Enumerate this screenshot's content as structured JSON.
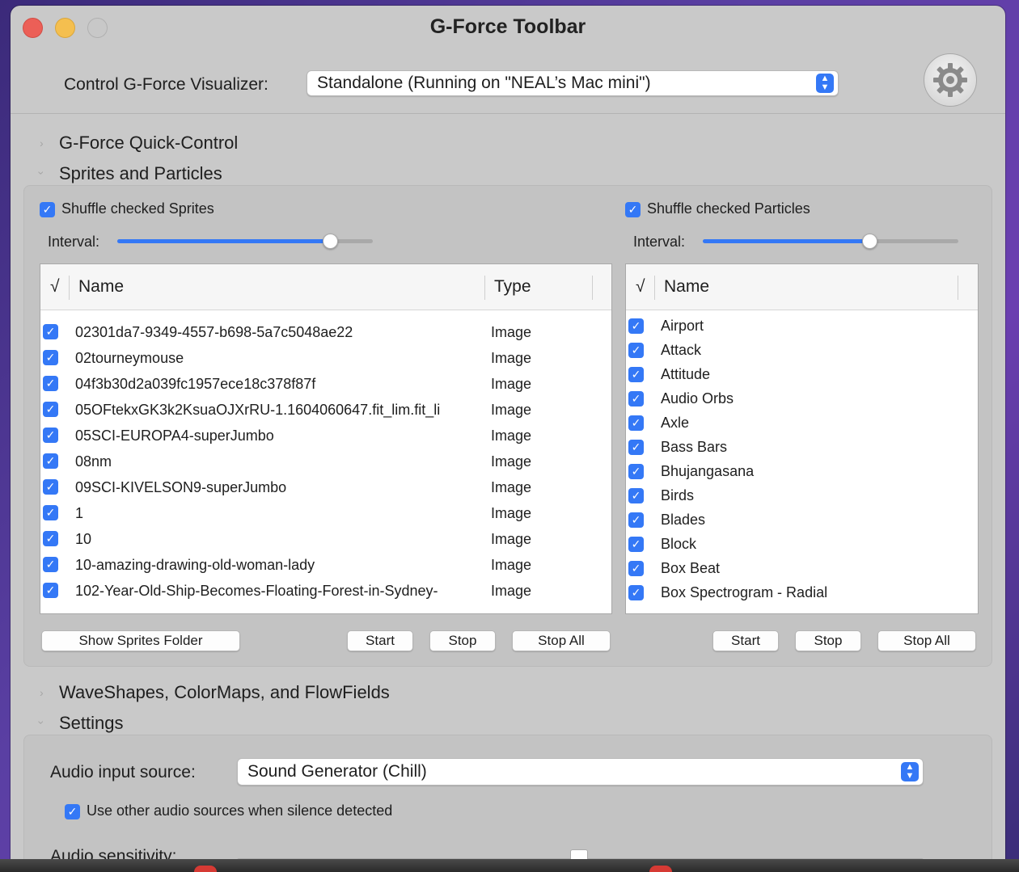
{
  "window": {
    "title": "G-Force Toolbar"
  },
  "control": {
    "label": "Control G-Force Visualizer:",
    "selected": "Standalone (Running on \"NEAL’s Mac mini\")"
  },
  "sections": {
    "quick_control": "G-Force Quick-Control",
    "sprites_particles": "Sprites and Particles",
    "waveshapes": "WaveShapes, ColorMaps, and FlowFields",
    "settings": "Settings"
  },
  "sprites": {
    "shuffle_label": "Shuffle checked Sprites",
    "interval_label": "Interval:",
    "interval_value": 0.84,
    "columns": {
      "check": "√",
      "name": "Name",
      "type": "Type"
    },
    "rows": [
      {
        "name": "02301da7-9349-4557-b698-5a7c5048ae22",
        "type": "Image"
      },
      {
        "name": "02tourneymouse",
        "type": "Image"
      },
      {
        "name": "04f3b30d2a039fc1957ece18c378f87f",
        "type": "Image"
      },
      {
        "name": "05OFtekxGK3k2KsuaOJXrRU-1.1604060647.fit_lim.fit_li",
        "type": "Image"
      },
      {
        "name": "05SCI-EUROPA4-superJumbo",
        "type": "Image"
      },
      {
        "name": "08nm",
        "type": "Image"
      },
      {
        "name": "09SCI-KIVELSON9-superJumbo",
        "type": "Image"
      },
      {
        "name": "1",
        "type": "Image"
      },
      {
        "name": "10",
        "type": "Image"
      },
      {
        "name": "10-amazing-drawing-old-woman-lady",
        "type": "Image"
      },
      {
        "name": "102-Year-Old-Ship-Becomes-Floating-Forest-in-Sydney-",
        "type": "Image"
      }
    ],
    "buttons": {
      "show_folder": "Show Sprites Folder",
      "start": "Start",
      "stop": "Stop",
      "stop_all": "Stop All"
    }
  },
  "particles": {
    "shuffle_label": "Shuffle checked Particles",
    "interval_label": "Interval:",
    "interval_value": 0.66,
    "columns": {
      "check": "√",
      "name": "Name"
    },
    "rows": [
      "Airport",
      "Attack",
      "Attitude",
      "Audio Orbs",
      "Axle",
      "Bass Bars",
      "Bhujangasana",
      "Birds",
      "Blades",
      "Block",
      "Box Beat",
      "Box Spectrogram - Radial"
    ],
    "buttons": {
      "start": "Start",
      "stop": "Stop",
      "stop_all": "Stop All"
    }
  },
  "settings": {
    "audio_input_label": "Audio input source:",
    "audio_input_selected": "Sound Generator (Chill)",
    "silence_option": "Use other audio sources when silence detected",
    "sensitivity_label": "Audio sensitivity:"
  }
}
